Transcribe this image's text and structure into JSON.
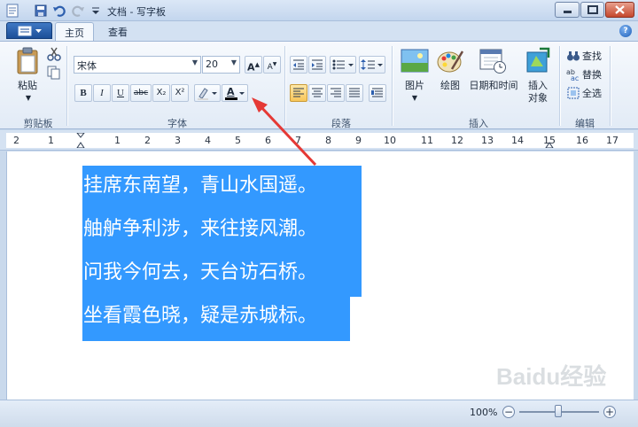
{
  "window": {
    "title": "文档 - 写字板"
  },
  "tabs": [
    {
      "label": "主页"
    },
    {
      "label": "查看"
    }
  ],
  "clipboard": {
    "paste_label": "粘贴",
    "group_label": "剪贴板"
  },
  "font": {
    "family_value": "宋体",
    "size_value": "20",
    "group_label": "字体",
    "bold_label": "B",
    "italic_label": "I",
    "underline_label": "U",
    "strike_label": "abc",
    "subscript_label": "X₂",
    "superscript_label": "X²",
    "grow_label": "A",
    "shrink_label": "A",
    "font_color_label": "A",
    "font_color": "#000000"
  },
  "paragraph": {
    "group_label": "段落"
  },
  "insert": {
    "picture_label": "图片",
    "paint_label": "绘图",
    "datetime_label": "日期和时间",
    "object_label": "插入对象",
    "group_label": "插入"
  },
  "editing": {
    "find_label": "查找",
    "replace_label": "替换",
    "select_all_label": "全选",
    "group_label": "编辑"
  },
  "ruler": {
    "marks": [
      "2",
      "1",
      "1",
      "2",
      "3",
      "4",
      "5",
      "6",
      "7",
      "8",
      "9",
      "10",
      "11",
      "12",
      "13",
      "14",
      "15",
      "16",
      "17"
    ]
  },
  "document": {
    "lines": [
      "挂席东南望，青山水国遥。",
      "舳舻争利涉，来往接风潮。",
      "问我今何去，天台访石桥。",
      "坐看霞色晓，疑是赤城标。"
    ],
    "selection_color": "#3399ff"
  },
  "status": {
    "zoom_label": "100%"
  },
  "watermark": {
    "text": "Baidu经验"
  },
  "colors": {
    "accent": "#3399ff",
    "annotation_arrow": "#e53935"
  }
}
